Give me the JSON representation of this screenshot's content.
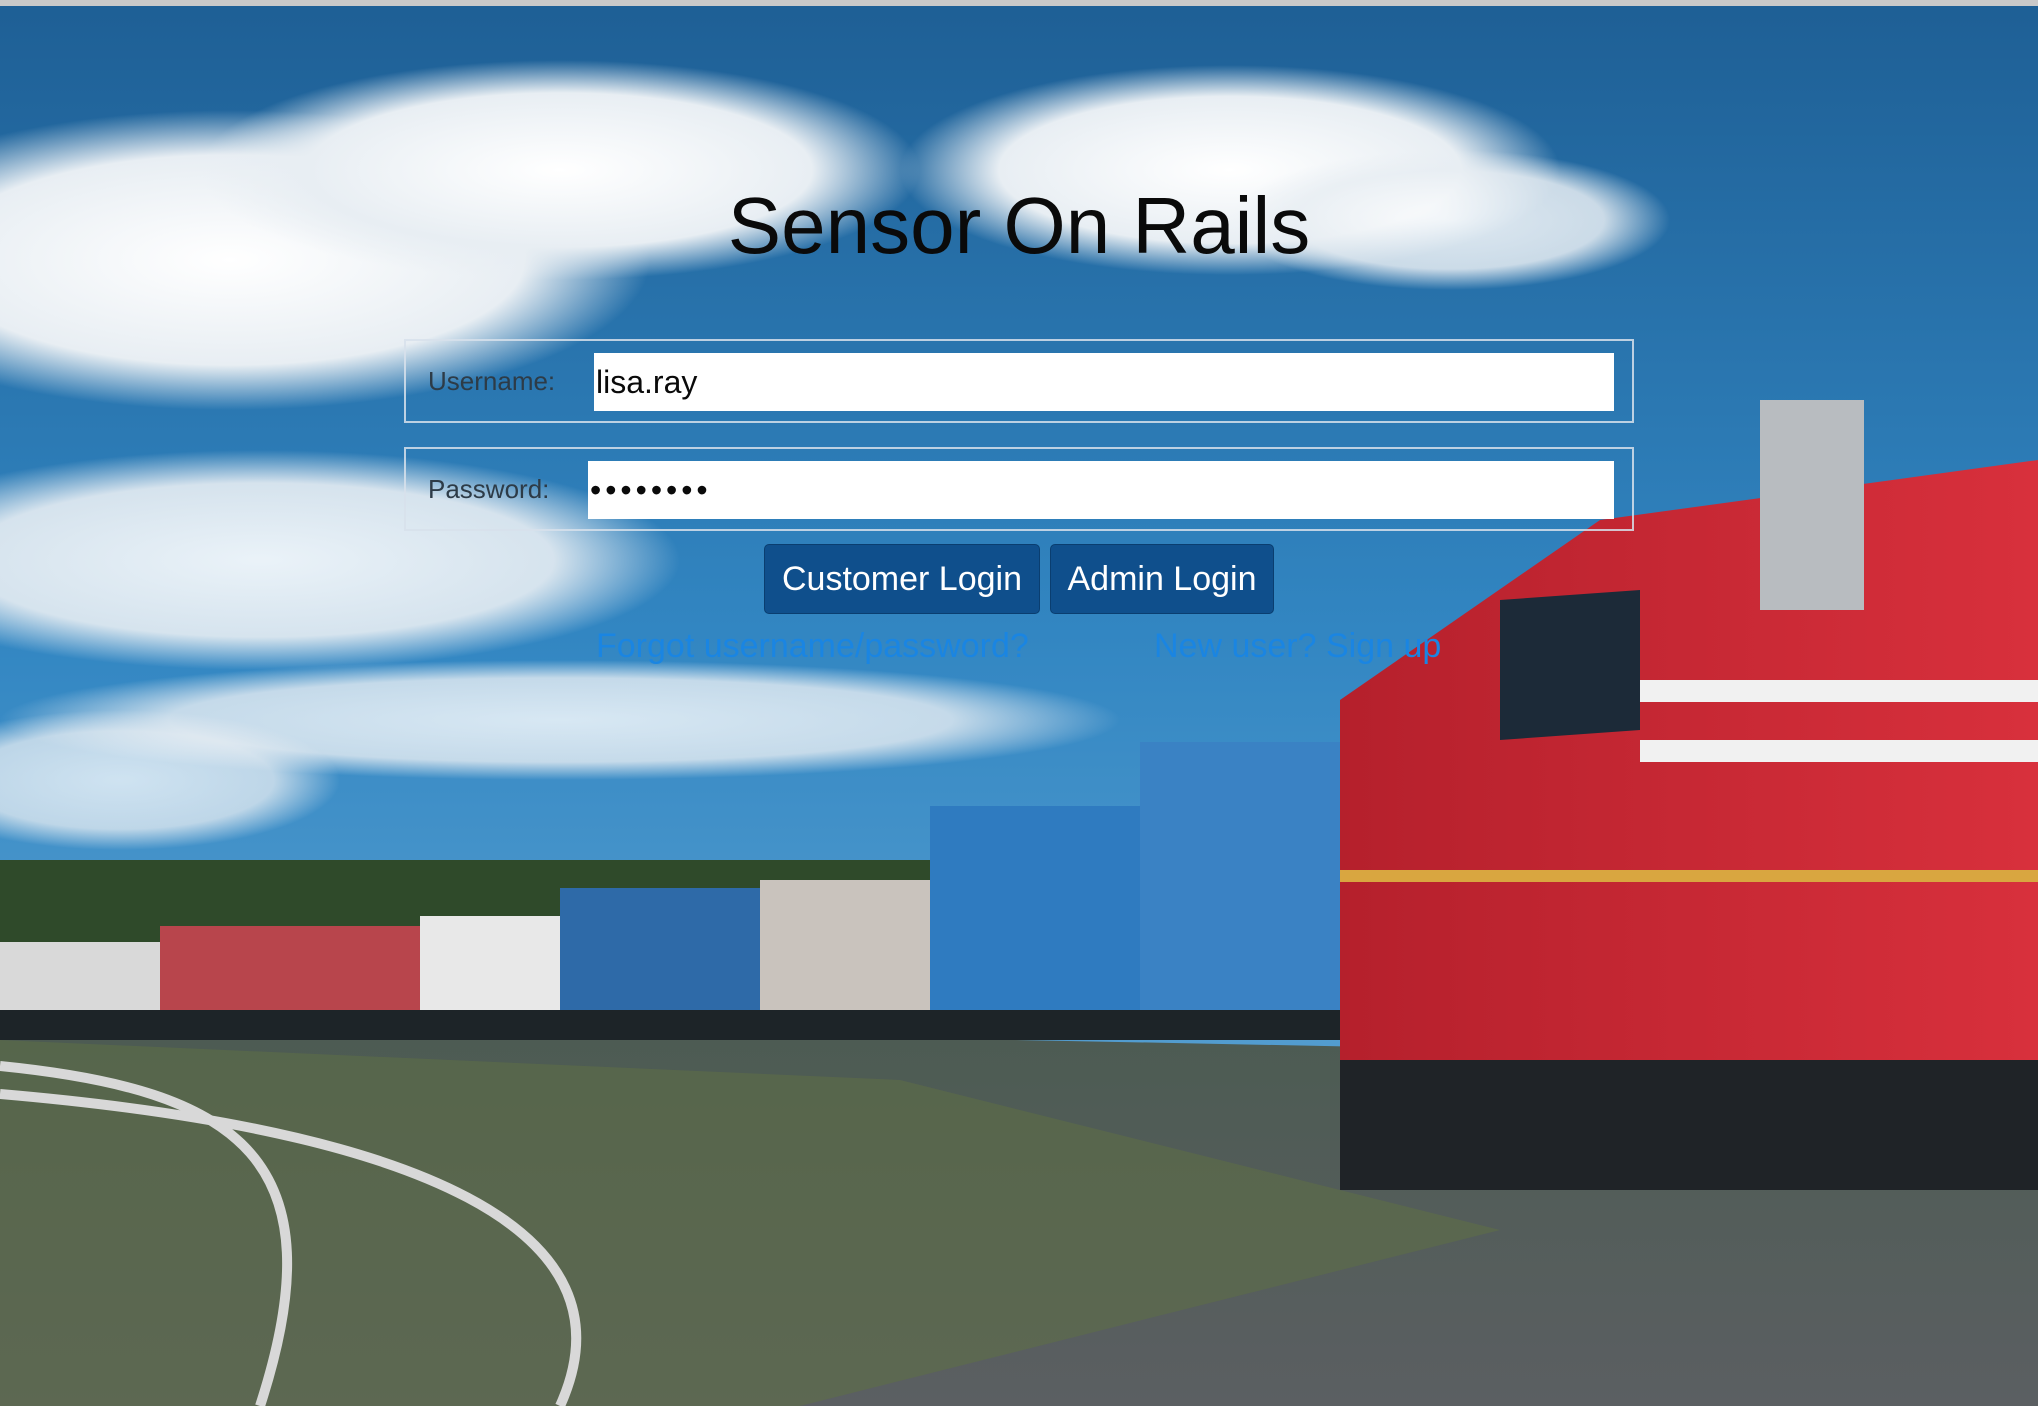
{
  "page": {
    "title": "Sensor On Rails"
  },
  "login_form": {
    "username": {
      "label": "Username:",
      "value": "lisa.ray"
    },
    "password": {
      "label": "Password:",
      "value": "••••••••"
    },
    "customer_login_label": "Customer Login",
    "admin_login_label": "Admin Login",
    "forgot_link": "Forgot username/password?",
    "signup_link": "New user? Sign up"
  },
  "colors": {
    "button_bg": "#0f4f8c",
    "link": "#1a85e2",
    "sky": "#2a78b3"
  },
  "background": {
    "scene": "freight train with red locomotive on curved railway tracks under blue sky with clouds"
  }
}
